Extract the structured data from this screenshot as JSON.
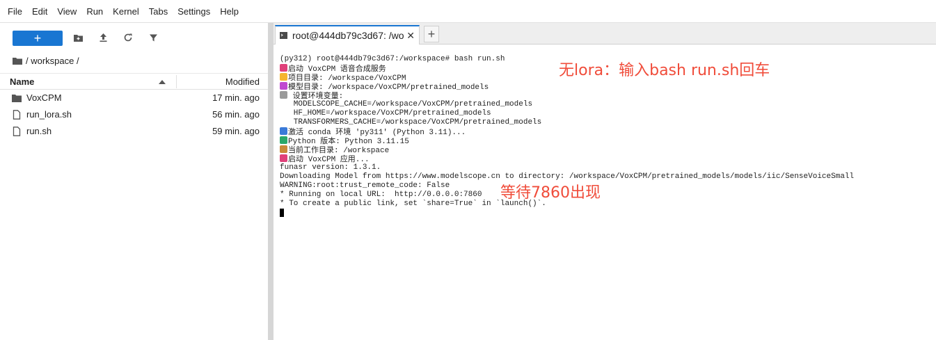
{
  "menu": [
    "File",
    "Edit",
    "View",
    "Run",
    "Kernel",
    "Tabs",
    "Settings",
    "Help"
  ],
  "filebrowser": {
    "new_label": "+",
    "breadcrumb": "/ workspace /",
    "col_name": "Name",
    "col_modified": "Modified",
    "files": [
      {
        "name": "VoxCPM",
        "modified": "17 min. ago",
        "icon": "folder-icon"
      },
      {
        "name": "run_lora.sh",
        "modified": "56 min. ago",
        "icon": "file-icon"
      },
      {
        "name": "run.sh",
        "modified": "59 min. ago",
        "icon": "file-icon"
      }
    ]
  },
  "terminal_tab": {
    "label": "root@444db79c3d67: /wo",
    "close": "✕",
    "add": "+"
  },
  "terminal_lines": [
    "(py312) root@444db79c3d67:/workspace# bash run.sh",
    "启动 VoxCPM 语音合成服务",
    "项目目录: /workspace/VoxCPM",
    "模型目录: /workspace/VoxCPM/pretrained_models",
    " 设置环境变量:",
    "   MODELSCOPE_CACHE=/workspace/VoxCPM/pretrained_models",
    "   HF_HOME=/workspace/VoxCPM/pretrained_models",
    "   TRANSFORMERS_CACHE=/workspace/VoxCPM/pretrained_models",
    "激活 conda 环境 'py311' (Python 3.11)...",
    "Python 版本: Python 3.11.15",
    "当前工作目录: /workspace",
    "启动 VoxCPM 应用...",
    "funasr version: 1.3.1.",
    "Downloading Model from https://www.modelscope.cn to directory: /workspace/VoxCPM/pretrained_models/models/iic/SenseVoiceSmall",
    "WARNING:root:trust_remote_code: False",
    "* Running on local URL:  http://0.0.0.0:7860",
    "* To create a public link, set `share=True` in `launch()`."
  ],
  "line_icon_colors": [
    "",
    "#e0407a",
    "#f5b52e",
    "#c04ad0",
    "#9a9a9a",
    "",
    "",
    "",
    "#3a7ad8",
    "#2aa86a",
    "#c98a3a",
    "#e0407a",
    "",
    "",
    "",
    "",
    ""
  ],
  "annotations": {
    "no_lora": "无lora：输入bash run.sh回车",
    "wait": "等待7860出现"
  },
  "colors": {
    "accent": "#1976d2",
    "annotation": "#f04c3a"
  }
}
